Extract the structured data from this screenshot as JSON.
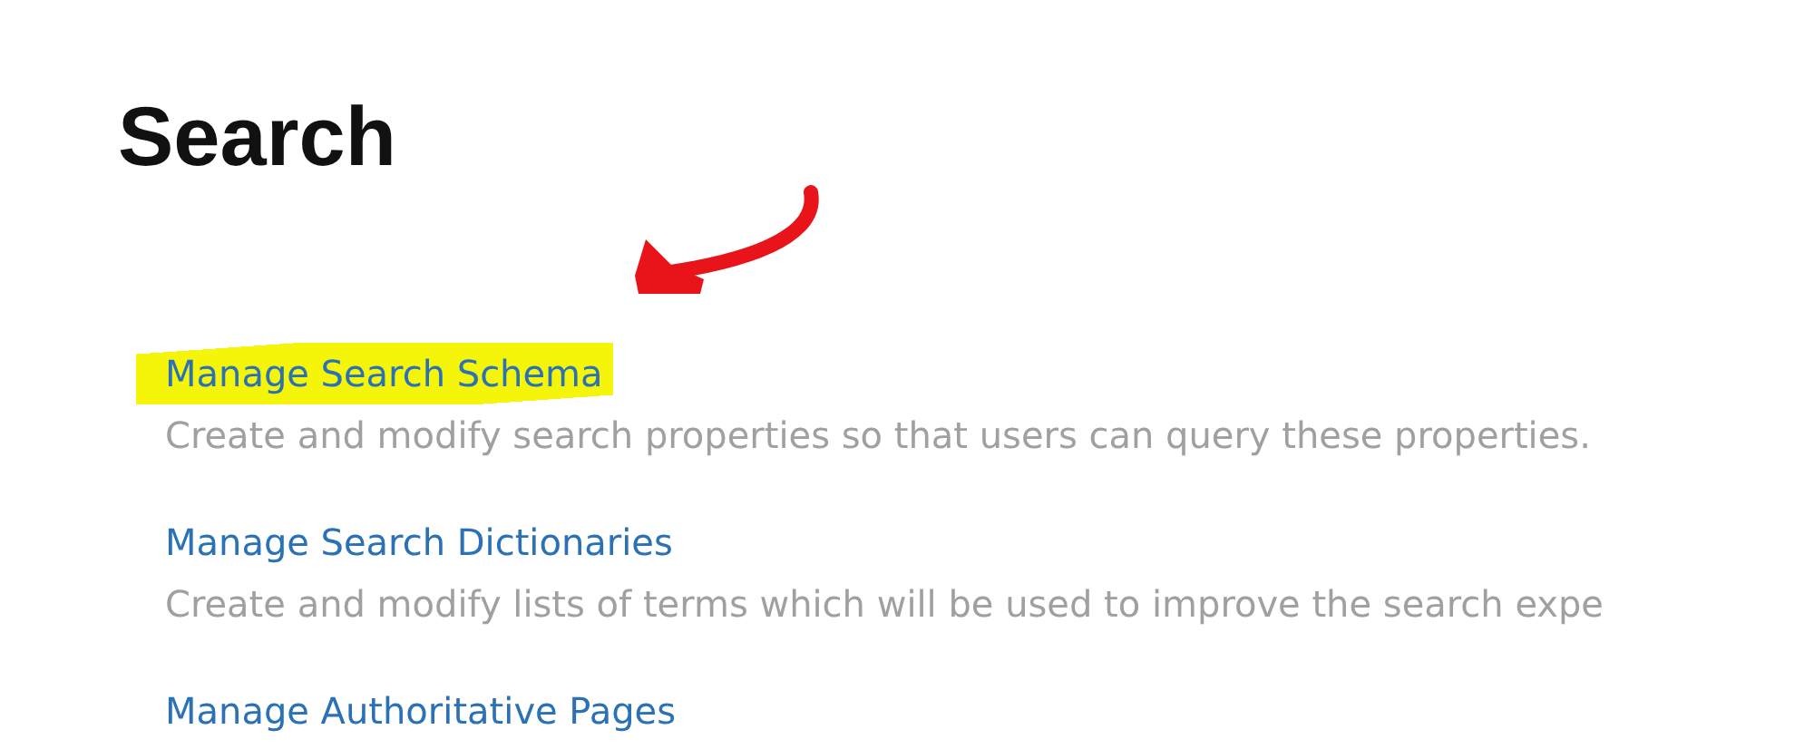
{
  "title": "Search",
  "annotation": {
    "kind": "arrow"
  },
  "items": [
    {
      "link": "Manage Search Schema",
      "description": "Create and modify search properties so that users can query these properties.",
      "highlighted": true
    },
    {
      "link": "Manage Search Dictionaries",
      "description": "Create and modify lists of terms which will be used to improve the search expe",
      "highlighted": false
    },
    {
      "link": "Manage Authoritative Pages",
      "highlighted": false
    }
  ]
}
